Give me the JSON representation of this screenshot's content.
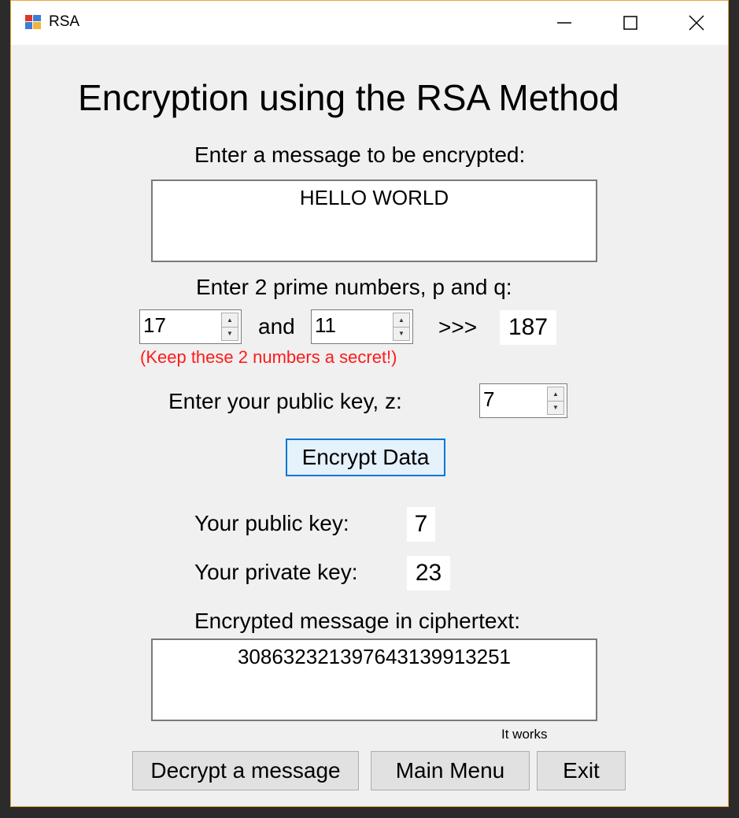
{
  "window": {
    "title": "RSA"
  },
  "heading": "Encryption using the RSA Method",
  "message": {
    "label": "Enter a message to be encrypted:",
    "value": "HELLO WORLD"
  },
  "primes": {
    "label": "Enter 2 prime numbers, p and q:",
    "p": "17",
    "and_label": "and",
    "q": "11",
    "arrow": ">>>",
    "product": "187",
    "warning": "(Keep these 2 numbers a secret!)"
  },
  "public_key_input": {
    "label": "Enter your public key, z:",
    "value": "7"
  },
  "encrypt_button": "Encrypt Data",
  "results": {
    "public_key_label": "Your public key:",
    "public_key_value": "7",
    "private_key_label": "Your private key:",
    "private_key_value": "23"
  },
  "ciphertext": {
    "label": "Encrypted message in ciphertext:",
    "value": "30863232139764313991325​1"
  },
  "status_note": "It works",
  "buttons": {
    "decrypt": "Decrypt a message",
    "main_menu": "Main Menu",
    "exit": "Exit"
  },
  "colors": {
    "warning": "#ff1a1a",
    "focus_border": "#0078d7",
    "window_border": "#e6a93a"
  },
  "icons": {
    "app": "app-window-icon",
    "minimize": "minimize-icon",
    "maximize": "maximize-icon",
    "close": "close-icon"
  }
}
